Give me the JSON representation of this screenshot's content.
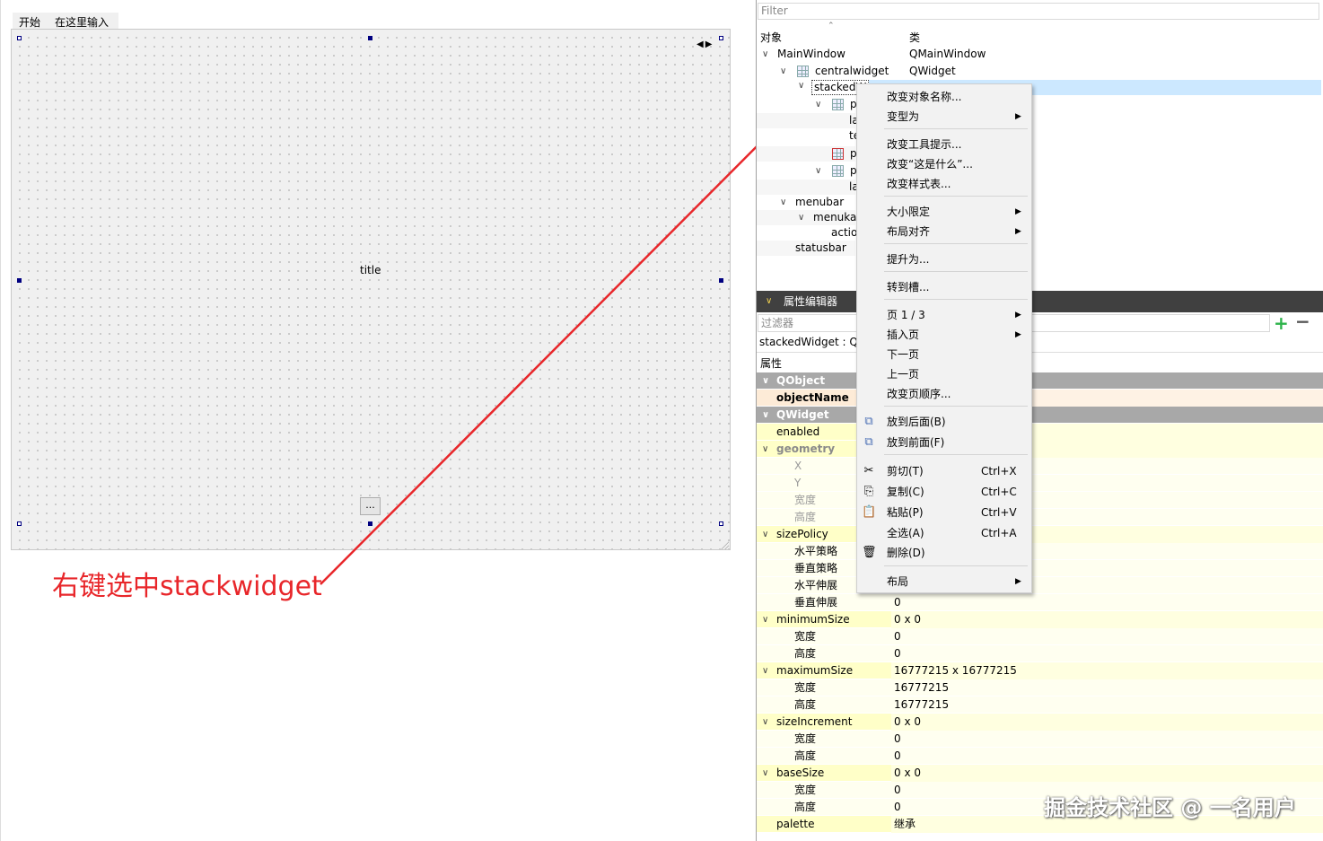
{
  "designer": {
    "menu_items": [
      "开始",
      "在这里输入"
    ],
    "title_label": "title",
    "more_button": "...",
    "nav_arrows": "◀▶"
  },
  "annotation": {
    "text": "右键选中stackwidget",
    "color": "#e8262a"
  },
  "object_inspector": {
    "filter_placeholder": "Filter",
    "col_object": "对象",
    "col_class": "类",
    "rows": [
      {
        "name": "MainWindow",
        "class": "QMainWindow"
      },
      {
        "name": "centralwidget",
        "class": "QWidget"
      },
      {
        "name": "stackedW",
        "class": ""
      },
      {
        "name": "p",
        "class": ""
      },
      {
        "name": "la",
        "class": ""
      },
      {
        "name": "te",
        "class": ""
      },
      {
        "name": "p",
        "class": ""
      },
      {
        "name": "p",
        "class": ""
      },
      {
        "name": "la",
        "class": ""
      },
      {
        "name": "menubar",
        "class": ""
      },
      {
        "name": "menuka",
        "class": ""
      },
      {
        "name": "actio",
        "class": ""
      },
      {
        "name": "statusbar",
        "class": ""
      }
    ]
  },
  "property_editor": {
    "title": "属性编辑器",
    "filter_placeholder": "过滤器",
    "object_label": "stackedWidget : Q",
    "col_property": "属性",
    "rows": [
      {
        "name": "QObject",
        "value": ""
      },
      {
        "name": "objectName",
        "value": ""
      },
      {
        "name": "QWidget",
        "value": ""
      },
      {
        "name": "enabled",
        "value": ""
      },
      {
        "name": "geometry",
        "value": ""
      },
      {
        "name": "X",
        "value": ""
      },
      {
        "name": "Y",
        "value": ""
      },
      {
        "name": "宽度",
        "value": ""
      },
      {
        "name": "高度",
        "value": ""
      },
      {
        "name": "sizePolicy",
        "value": ""
      },
      {
        "name": "水平策略",
        "value": ""
      },
      {
        "name": "垂直策略",
        "value": ""
      },
      {
        "name": "水平伸展",
        "value": ""
      },
      {
        "name": "垂直伸展",
        "value": "0"
      },
      {
        "name": "minimumSize",
        "value": "0 x 0"
      },
      {
        "name": "宽度",
        "value": "0"
      },
      {
        "name": "高度",
        "value": "0"
      },
      {
        "name": "maximumSize",
        "value": "16777215 x 16777215"
      },
      {
        "name": "宽度",
        "value": "16777215"
      },
      {
        "name": "高度",
        "value": "16777215"
      },
      {
        "name": "sizeIncrement",
        "value": "0 x 0"
      },
      {
        "name": "宽度",
        "value": "0"
      },
      {
        "name": "高度",
        "value": "0"
      },
      {
        "name": "baseSize",
        "value": "0 x 0"
      },
      {
        "name": "宽度",
        "value": "0"
      },
      {
        "name": "高度",
        "value": "0"
      },
      {
        "name": "palette",
        "value": "继承"
      }
    ]
  },
  "context_menu": {
    "items": [
      {
        "label": "改变对象名称..."
      },
      {
        "label": "变型为",
        "submenu": true
      },
      {
        "label": "改变工具提示..."
      },
      {
        "label": "改变“这是什么”..."
      },
      {
        "label": "改变样式表..."
      },
      {
        "label": "大小限定",
        "submenu": true
      },
      {
        "label": "布局对齐",
        "submenu": true
      },
      {
        "label": "提升为..."
      },
      {
        "label": "转到槽..."
      },
      {
        "label": "页 1 / 3",
        "submenu": true
      },
      {
        "label": "插入页",
        "submenu": true
      },
      {
        "label": "下一页"
      },
      {
        "label": "上一页"
      },
      {
        "label": "改变页顺序..."
      },
      {
        "label": "放到后面(B)",
        "icon": "send-to-back-icon"
      },
      {
        "label": "放到前面(F)",
        "icon": "bring-to-front-icon"
      },
      {
        "label": "剪切(T)",
        "shortcut": "Ctrl+X",
        "icon": "cut-icon"
      },
      {
        "label": "复制(C)",
        "shortcut": "Ctrl+C",
        "icon": "copy-icon"
      },
      {
        "label": "粘贴(P)",
        "shortcut": "Ctrl+V",
        "icon": "paste-icon"
      },
      {
        "label": "全选(A)",
        "shortcut": "Ctrl+A"
      },
      {
        "label": "删除(D)",
        "icon": "delete-icon"
      },
      {
        "label": "布局",
        "submenu": true
      }
    ]
  },
  "watermark": "掘金技术社区 @ 一名用户",
  "colors": {
    "selection": "#cce8ff",
    "group_row": "#a8a8a8",
    "property_yellow": "#ffffe0",
    "handle": "#000080",
    "plus_green": "#2db34a"
  }
}
